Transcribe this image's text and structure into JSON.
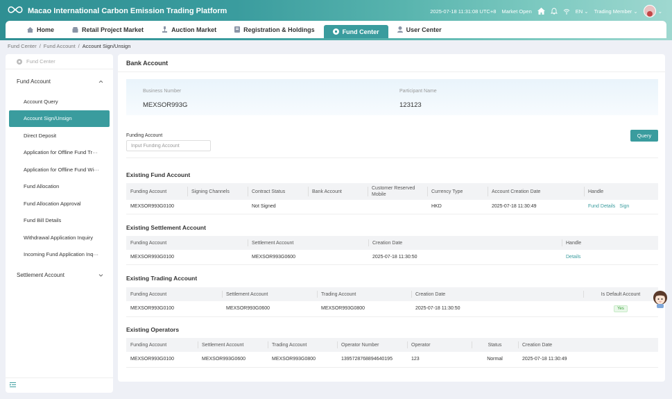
{
  "app": {
    "title": "Macao International Carbon Emission Trading Platform",
    "datetime": "2025-07-18 11:31:08 UTC+8",
    "market_status": "Market Open",
    "language": "EN",
    "user_role": "Trading Member"
  },
  "nav": {
    "items": [
      {
        "label": "Home",
        "icon": "home-icon"
      },
      {
        "label": "Retail Project Market",
        "icon": "shop-icon"
      },
      {
        "label": "Auction Market",
        "icon": "gavel-icon"
      },
      {
        "label": "Registration & Holdings",
        "icon": "document-icon"
      },
      {
        "label": "Fund Center",
        "icon": "fund-icon",
        "active": true
      },
      {
        "label": "User Center",
        "icon": "user-icon"
      }
    ]
  },
  "breadcrumb": {
    "items": [
      "Fund Center",
      "Fund Account"
    ],
    "current": "Account Sign/Unsign"
  },
  "sidebar": {
    "header": "Fund Center",
    "group_fund": "Fund Account",
    "items": [
      "Account Query",
      "Account Sign/Unsign",
      "Direct Deposit",
      "Application for Offline Fund Tr···",
      "Application for Offline Fund Wi···",
      "Fund Allocation",
      "Fund Allocation Approval",
      "Fund Bill Details",
      "Withdrawal Application Inquiry",
      "Incoming Fund Application Inq···"
    ],
    "group_settlement": "Settlement Account"
  },
  "main": {
    "title": "Bank Account",
    "business_number_label": "Business Number",
    "business_number": "MEXSOR993G",
    "participant_name_label": "Participant Name",
    "participant_name": "123123",
    "funding_account_label": "Funding Account",
    "funding_account_placeholder": "Input Funding Account",
    "query_label": "Query"
  },
  "fund_accounts": {
    "title": "Existing Fund Account",
    "headers": [
      "Funding Account",
      "Signing Channels",
      "Contract Status",
      "Bank Account",
      "Customer Reserved Mobile",
      "Currency Type",
      "Account Creation Date",
      "Handle"
    ],
    "row": {
      "funding_account": "MEXSOR993G0100",
      "signing_channels": "",
      "contract_status": "Not Signed",
      "bank_account": "",
      "mobile": "",
      "currency": "HKD",
      "creation_date": "2025-07-18 11:30:49",
      "link1": "Fund Details",
      "link2": "Sign"
    }
  },
  "settlement_accounts": {
    "title": "Existing Settlement Account",
    "headers": [
      "Funding Account",
      "Settlement Account",
      "Creation Date",
      "Handle"
    ],
    "row": {
      "funding_account": "MEXSOR993G0100",
      "settlement_account": "MEXSOR993G0600",
      "creation_date": "2025-07-18 11:30:50",
      "link": "Details"
    }
  },
  "trading_accounts": {
    "title": "Existing Trading Account",
    "headers": [
      "Funding Account",
      "Settlement Account",
      "Trading Account",
      "Creation Date",
      "Is Default Account"
    ],
    "row": {
      "funding_account": "MEXSOR993G0100",
      "settlement_account": "MEXSOR993G0600",
      "trading_account": "MEXSOR993G0800",
      "creation_date": "2025-07-18 11:30:50",
      "is_default": "Yes"
    }
  },
  "operators": {
    "title": "Existing Operators",
    "headers": [
      "Funding Account",
      "Settlement Account",
      "Trading Account",
      "Operator Number",
      "Operator",
      "Status",
      "Creation Date"
    ],
    "row": {
      "funding_account": "MEXSOR993G0100",
      "settlement_account": "MEXSOR993G0600",
      "trading_account": "MEXSOR993G0800",
      "operator_number": "1395728768894640195",
      "operator": "123",
      "status": "Normal",
      "creation_date": "2025-07-18 11:30:49"
    }
  },
  "colors": {
    "accent": "#3a9c9e",
    "link": "#3a9c9e",
    "yes_tag": "#3aa03a"
  }
}
